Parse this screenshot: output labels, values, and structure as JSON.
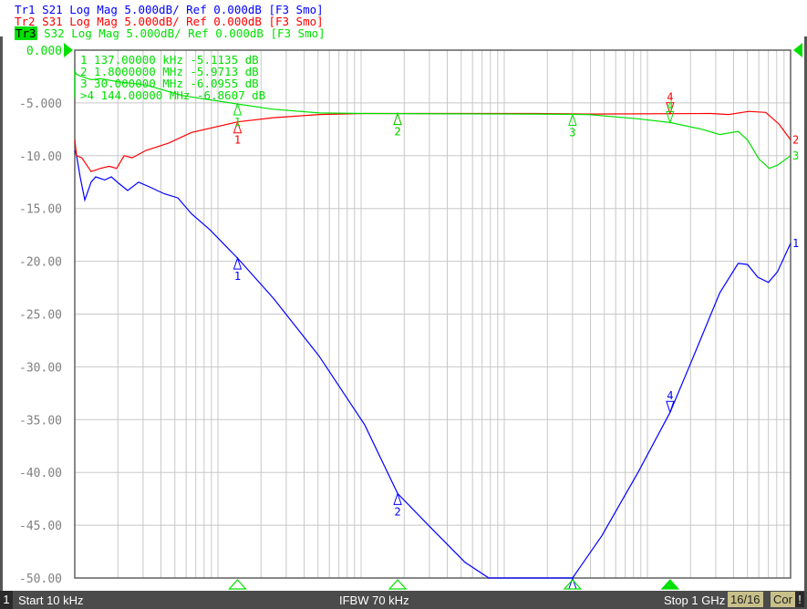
{
  "traces": [
    {
      "id": "Tr1",
      "label": "Tr1 S21 Log Mag 5.000dB/ Ref 0.000dB [F3 Smo]",
      "name": "Tr1",
      "rest": " S21 Log Mag 5.000dB/ Ref 0.000dB [F3 Smo]",
      "color": "#0000ff",
      "points": [
        [
          10000.0,
          -9.5
        ],
        [
          10300.0,
          -10
        ],
        [
          10900.0,
          -12
        ],
        [
          11750.0,
          -14.2
        ],
        [
          13000.0,
          -12.5
        ],
        [
          14000.0,
          -12
        ],
        [
          16200.0,
          -12.3
        ],
        [
          18000.0,
          -12
        ],
        [
          20200.0,
          -12.6
        ],
        [
          23400.0,
          -13.3
        ],
        [
          27900.0,
          -12.5
        ],
        [
          33800.0,
          -13
        ],
        [
          42100.0,
          -13.6
        ],
        [
          52500.0,
          -14
        ],
        [
          65400.0,
          -15.5
        ],
        [
          87700.0,
          -17
        ],
        [
          137000.0,
          -19.7
        ],
        [
          244000.0,
          -23.5
        ],
        [
          510000.0,
          -29
        ],
        [
          1060000.0,
          -35.5
        ],
        [
          1800000.0,
          -42
        ],
        [
          2950000.0,
          -45
        ],
        [
          5300000.0,
          -48.5
        ],
        [
          7800000.0,
          -50
        ],
        [
          30000000.0,
          -50
        ],
        [
          48000000.0,
          -46
        ],
        [
          86000000.0,
          -40
        ],
        [
          144000000.0,
          -34.3
        ],
        [
          210000000.0,
          -29
        ],
        [
          320000000.0,
          -23
        ],
        [
          430000000.0,
          -20.2
        ],
        [
          500000000.0,
          -20.3
        ],
        [
          590000000.0,
          -21.5
        ],
        [
          700000000.0,
          -22
        ],
        [
          810000000.0,
          -21
        ],
        [
          1000000000.0,
          -18.3
        ]
      ],
      "markers": [
        {
          "n": "1",
          "f": 137000.0,
          "dir": "up"
        },
        {
          "n": "2",
          "f": 1800000.0,
          "dir": "up"
        },
        {
          "n": "3",
          "f": 30000000.0,
          "dir": "up"
        },
        {
          "n": "4",
          "f": 144000000.0,
          "dir": "down"
        }
      ],
      "end_label": "1"
    },
    {
      "id": "Tr2",
      "label": "Tr2 S31 Log Mag 5.000dB/ Ref 0.000dB [F3 Smo]",
      "name": "Tr2",
      "rest": " S31 Log Mag 5.000dB/ Ref 0.000dB [F3 Smo]",
      "color": "#ff0000",
      "points": [
        [
          10000.0,
          -8.5
        ],
        [
          10300.0,
          -10
        ],
        [
          11200.0,
          -10.2
        ],
        [
          13000.0,
          -11.5
        ],
        [
          15100.0,
          -11.2
        ],
        [
          17400.0,
          -11
        ],
        [
          19600.0,
          -11.2
        ],
        [
          22100.0,
          -10
        ],
        [
          25200.0,
          -10.2
        ],
        [
          31400.0,
          -9.5
        ],
        [
          45300.0,
          -8.8
        ],
        [
          65400.0,
          -7.8
        ],
        [
          137000.0,
          -6.8
        ],
        [
          244000.0,
          -6.4
        ],
        [
          510000.0,
          -6.1
        ],
        [
          1060000.0,
          -6.0
        ],
        [
          16300000.0,
          -6.0
        ],
        [
          38600000.0,
          -6.05
        ],
        [
          278000000.0,
          -6.0
        ],
        [
          370000000.0,
          -6.1
        ],
        [
          510000000.0,
          -5.8
        ],
        [
          670000000.0,
          -5.9
        ],
        [
          830000000.0,
          -7
        ],
        [
          1000000000.0,
          -8.5
        ]
      ],
      "markers": [
        {
          "n": "1",
          "f": 137000.0,
          "dir": "up"
        },
        {
          "n": "2",
          "f": 1800000.0,
          "dir": "up"
        },
        {
          "n": "4",
          "f": 144000000.0,
          "dir": "down"
        }
      ],
      "end_label": "2"
    },
    {
      "id": "Tr3",
      "label": "Tr3 S32 Log Mag 5.000dB/ Ref 0.000dB [F3 Smo]",
      "name": "Tr3",
      "rest": " S32 Log Mag 5.000dB/ Ref 0.000dB [F3 Smo]",
      "color": "#00e000",
      "points": [
        [
          10000.0,
          -4.5
        ],
        [
          10000.0,
          -2
        ],
        [
          10300.0,
          -2.3
        ],
        [
          11200.0,
          -2.5
        ],
        [
          13000.0,
          -2.8
        ],
        [
          15100.0,
          -2.7
        ],
        [
          20200.0,
          -3
        ],
        [
          31400.0,
          -3.3
        ],
        [
          56400.0,
          -4.3
        ],
        [
          137000.0,
          -5.1
        ],
        [
          244000.0,
          -5.6
        ],
        [
          510000.0,
          -5.95
        ],
        [
          1060000.0,
          -6.0
        ],
        [
          16300000.0,
          -6.05
        ],
        [
          38600000.0,
          -6.1
        ],
        [
          86000000.0,
          -6.5
        ],
        [
          144000000.0,
          -6.86
        ],
        [
          240000000.0,
          -7.5
        ],
        [
          320000000.0,
          -8
        ],
        [
          430000000.0,
          -7.7
        ],
        [
          500000000.0,
          -8.5
        ],
        [
          600000000.0,
          -10.3
        ],
        [
          710000000.0,
          -11.2
        ],
        [
          810000000.0,
          -10.9
        ],
        [
          1000000000.0,
          -10
        ]
      ],
      "markers": [
        {
          "n": "1",
          "f": 137000.0,
          "dir": "up"
        },
        {
          "n": "2",
          "f": 1800000.0,
          "dir": "up"
        },
        {
          "n": "3",
          "f": 30000000.0,
          "dir": "up"
        },
        {
          "n": "4",
          "f": 144000000.0,
          "dir": "down"
        }
      ],
      "end_label": "3"
    }
  ],
  "marker_table": [
    " 1  137.00000 kHz -5.1135 dB",
    " 2  1.8000000 MHz -5.9713 dB",
    " 3  30.000000 MHz -6.0955 dB",
    ">4  144.00000 MHz -6.8607 dB"
  ],
  "axis": {
    "ref_label": "0.000",
    "y_labels": [
      "0.000",
      "-5.000",
      "-10.00",
      "-15.00",
      "-20.00",
      "-25.00",
      "-30.00",
      "-35.00",
      "-40.00",
      "-45.00",
      "-50.00"
    ],
    "y_min": -50,
    "y_max": 0,
    "f_start": 10000,
    "f_stop": 1000000000
  },
  "status": {
    "channel": "1",
    "start": "Start 10 kHz",
    "ifbw": "IFBW 70 kHz",
    "stop": "Stop 1 GHz",
    "avg": "16/16",
    "cor": "Cor",
    "alert": "!"
  },
  "colors": {
    "grid": "#c8c8c8",
    "axis_label": "#808080",
    "active": "#00e000"
  }
}
